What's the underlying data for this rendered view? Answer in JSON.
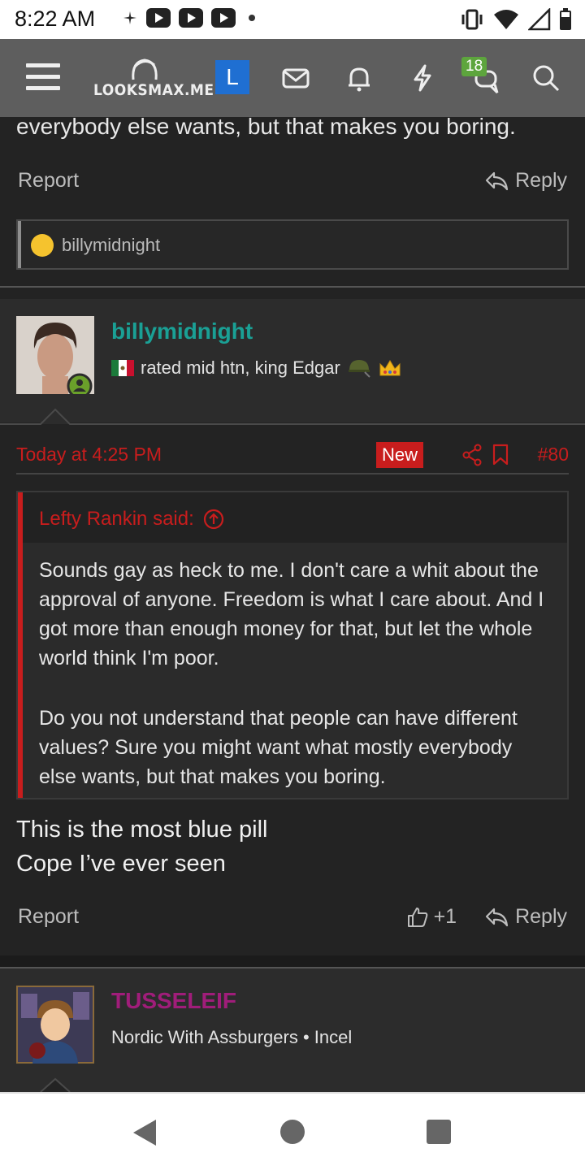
{
  "status_bar": {
    "time": "8:22 AM",
    "icons": [
      "fan-icon",
      "youtube-icon",
      "youtube-icon",
      "youtube-icon",
      "dot-icon",
      "vibrate-icon",
      "wifi-icon",
      "signal-icon",
      "battery-icon"
    ]
  },
  "header": {
    "brand": "LOOKSMAX.ME",
    "user_initial": "L",
    "conversations_badge": "18",
    "colors": {
      "background": "#5e5e5e",
      "avatar": "#1f6fd2",
      "badge": "#5da53d"
    }
  },
  "previous_post": {
    "tail_text": "everybody else wants, but that makes you boring.",
    "report_label": "Report",
    "reply_label": "Reply",
    "liked_by": "billymidnight"
  },
  "post": {
    "author": "billymidnight",
    "author_color": "#1aa095",
    "user_title": "rated mid htn, king Edgar",
    "date": "Today at 4:25 PM",
    "new_badge": "New",
    "post_number": "#80",
    "quote": {
      "author_line": "Lefty Rankin said:",
      "paragraph_1": "Sounds gay as heck to me. I don't care a whit about the approval of anyone. Freedom is what I care about. And I got more than enough money for that, but let the whole world think I'm poor.",
      "paragraph_2": "Do you not understand that people can have different values? Sure you might want what mostly everybody else wants, but that makes you boring."
    },
    "body_line_1": "This is the most blue pill",
    "body_line_2": "Cope I’ve ever seen",
    "report_label": "Report",
    "like_count": "+1",
    "reply_label": "Reply"
  },
  "next_post": {
    "author": "TUSSELEIF",
    "user_title": "Nordic With Assburgers • Incel"
  },
  "accent_color": "#c81d1d"
}
